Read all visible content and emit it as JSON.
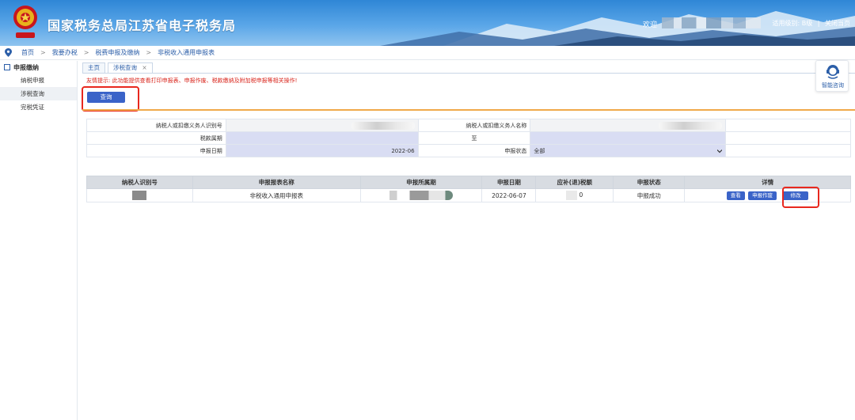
{
  "header": {
    "site_title": "国家税务总局江苏省电子税务局",
    "welcome": "欢迎",
    "user_type": "适用级别: B级",
    "separator": "|",
    "close_page": "关闭当页"
  },
  "breadcrumb": {
    "items": [
      "首页",
      "我要办税",
      "税费申报及缴纳",
      "非税收入通用申报表"
    ],
    "separator": ">"
  },
  "sidebar": {
    "heading": "申报缴纳",
    "items": [
      {
        "label": "纳税申报",
        "active": false
      },
      {
        "label": "涉税查询",
        "active": true
      },
      {
        "label": "完税凭证",
        "active": false
      }
    ]
  },
  "tabs": [
    {
      "label": "主页"
    },
    {
      "label": "涉税查询",
      "close": "×"
    }
  ],
  "tip": "友情提示: 此功能提供查看打印申报表、申报作废、税款缴纳及附加税申报等相关操作!",
  "query_button": "查询",
  "help": {
    "label": "智能咨询"
  },
  "form": {
    "taxpayer_id_label": "纳税人或扣缴义务人识别号",
    "taxpayer_name_label": "纳税人或扣缴义务人名称",
    "tax_period_label": "税款属期",
    "to_label": "至",
    "declare_date_label": "申报日期",
    "declare_date_value": "2022-06",
    "declare_status_label": "申报状态",
    "declare_status_value": "全部"
  },
  "results": {
    "columns": [
      "纳税人识别号",
      "申报报表名称",
      "申报所属期",
      "申报日期",
      "应补(退)税额",
      "申报状态",
      "详情"
    ],
    "rows": [
      {
        "report_name": "非税收入通用申报表",
        "declare_date": "2022-06-07",
        "tax_amount": "0",
        "status": "申报成功",
        "actions": [
          "查看",
          "申报作废",
          "修改"
        ]
      }
    ]
  },
  "colors": {
    "brand_blue": "#3a63c8",
    "highlight_red": "#e8281e",
    "tip_red": "#d9251c",
    "field_fill": "#d9ddf3",
    "divider_orange": "#f0a94a"
  }
}
